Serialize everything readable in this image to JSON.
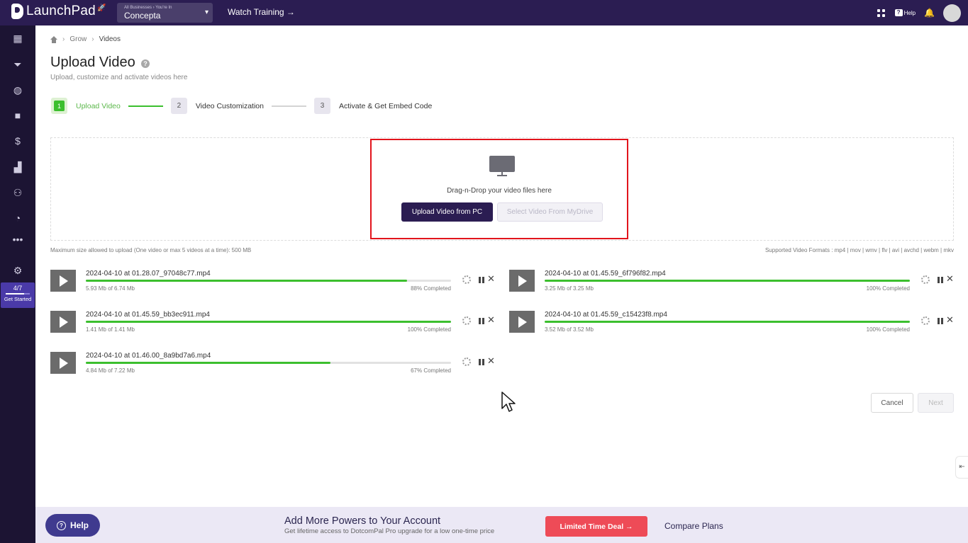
{
  "topbar": {
    "brand": "LaunchPad",
    "business_crumb": "All Businesses › You're In",
    "business_name": "Concepta",
    "watch_training": "Watch Training →",
    "help": "Help"
  },
  "sidebar": {
    "icons": [
      "dashboard-icon",
      "funnel-icon",
      "globe-icon",
      "video-icon",
      "dollar-icon",
      "analytics-icon",
      "users-icon",
      "gauge-icon",
      "more-icon",
      "settings-icon"
    ],
    "get_started": {
      "count": "4/7",
      "label": "Get Started",
      "progress": 0.571
    }
  },
  "breadcrumb": {
    "items": [
      "Grow",
      "Videos"
    ]
  },
  "page": {
    "title": "Upload Video",
    "subtitle": "Upload, customize and activate videos here"
  },
  "stepper": [
    {
      "num": "1",
      "label": "Upload Video"
    },
    {
      "num": "2",
      "label": "Video Customization"
    },
    {
      "num": "3",
      "label": "Activate & Get Embed Code"
    }
  ],
  "dropzone": {
    "text": "Drag-n-Drop your video files here",
    "upload_pc": "Upload Video from PC",
    "mydrive": "Select Video From MyDrive"
  },
  "info": {
    "max_size": "Maximum size allowed to upload (One video or max 5 videos at a time): 500 MB",
    "formats": "Supported Video Formats : mp4 | mov | wmv | flv | avi | avchd | webm | mkv"
  },
  "files": [
    {
      "name": "2024-04-10 at 01.28.07_97048c77.mp4",
      "size": "5.93 Mb of 6.74 Mb",
      "pct": "88% Completed",
      "progress": 0.88
    },
    {
      "name": "2024-04-10 at 01.45.59_6f796f82.mp4",
      "size": "3.25 Mb of 3.25 Mb",
      "pct": "100% Completed",
      "progress": 1.0
    },
    {
      "name": "2024-04-10 at 01.45.59_bb3ec911.mp4",
      "size": "1.41 Mb of 1.41 Mb",
      "pct": "100% Completed",
      "progress": 1.0
    },
    {
      "name": "2024-04-10 at 01.45.59_c15423f8.mp4",
      "size": "3.52 Mb of 3.52 Mb",
      "pct": "100% Completed",
      "progress": 1.0
    },
    {
      "name": "2024-04-10 at 01.46.00_8a9bd7a6.mp4",
      "size": "4.84 Mb of 7.22 Mb",
      "pct": "67% Completed",
      "progress": 0.67
    }
  ],
  "actions": {
    "cancel": "Cancel",
    "next": "Next"
  },
  "footer": {
    "help": "Help",
    "promo_title": "Add More Powers to Your Account",
    "promo_sub": "Get lifetime access to DotcomPal Pro upgrade for a low one-time price",
    "deal": "Limited Time Deal →",
    "compare": "Compare Plans"
  },
  "colors": {
    "brand": "#2b1d52",
    "accent_green": "#3cbf2e",
    "deal_red": "#ee4b57",
    "highlight_red": "#e2141c"
  }
}
